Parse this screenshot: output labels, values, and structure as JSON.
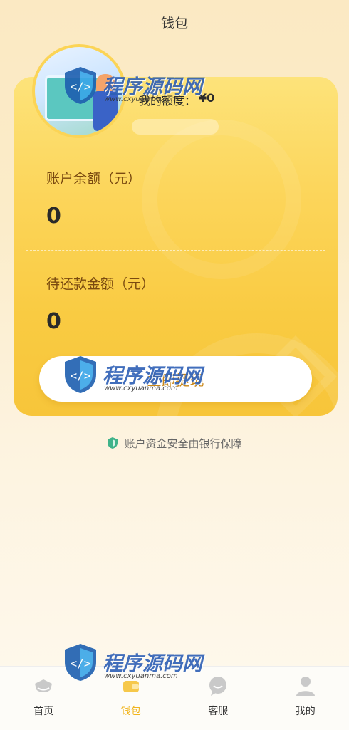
{
  "header": {
    "title": "钱包"
  },
  "card": {
    "quota_label": "我的额度：",
    "quota_value": "¥0",
    "balance_label": "账户余额（元）",
    "balance_value": "0",
    "repay_label": "待还款金额（元）",
    "repay_value": "0",
    "withdraw_label": "立即提现"
  },
  "security": {
    "text": "账户资金安全由银行保障"
  },
  "watermark": {
    "name": "程序源码网",
    "url": "www.cxyuanma.com"
  },
  "tabbar": {
    "items": [
      {
        "label": "首页",
        "icon": "home-icon"
      },
      {
        "label": "钱包",
        "icon": "wallet-icon",
        "active": true
      },
      {
        "label": "客服",
        "icon": "chat-icon"
      },
      {
        "label": "我的",
        "icon": "user-icon"
      }
    ]
  },
  "colors": {
    "accent": "#f1b51e",
    "card": "#fcd55a",
    "label": "#7a4a10"
  }
}
